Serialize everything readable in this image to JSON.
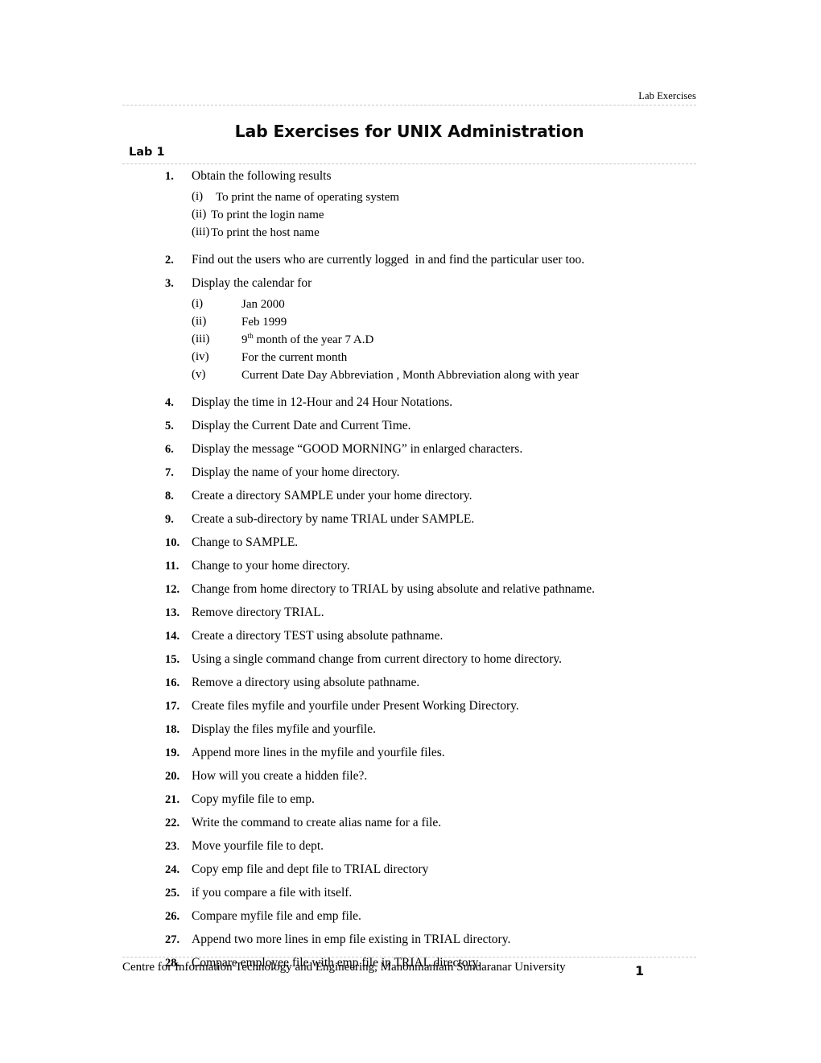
{
  "header": {
    "running_head": "Lab Exercises"
  },
  "title": "Lab Exercises for UNIX Administration",
  "lab_heading": "Lab 1",
  "exercises": [
    {
      "number": "1.",
      "text": "Obtain the following results",
      "sub": [
        {
          "label": "(i)",
          "value": "To print the name of operating system"
        },
        {
          "label": "(ii)",
          "value": "To print the login name"
        },
        {
          "label": "(iii)",
          "value": "To print the host name"
        }
      ]
    },
    {
      "number": "2.",
      "text": "Find out the users who are currently logged  in and find the particular user too."
    },
    {
      "number": "3.",
      "text": "Display the calendar for",
      "sub": [
        {
          "label": "(i)",
          "value": "Jan 2000"
        },
        {
          "label": "(ii)",
          "value": "Feb 1999"
        },
        {
          "label": "(iii)",
          "value_pre": "9",
          "value_sup": "th",
          "value_post": " month of the year 7 A.D"
        },
        {
          "label": "(iv)",
          "value": "For the current month"
        },
        {
          "label": "(v)",
          "value": "Current Date Day Abbreviation , Month Abbreviation along with year"
        }
      ]
    },
    {
      "number": "4.",
      "text": "Display the time in 12-Hour and 24 Hour Notations."
    },
    {
      "number": "5.",
      "text": "Display the Current Date and Current Time."
    },
    {
      "number": "6.",
      "text": "Display the message “GOOD MORNING” in enlarged characters."
    },
    {
      "number": "7.",
      "text": "Display the name of your home directory."
    },
    {
      "number": "8.",
      "text": "Create a directory SAMPLE under your home directory."
    },
    {
      "number": "9.",
      "text": "Create a sub-directory by name TRIAL under SAMPLE."
    },
    {
      "number": "10.",
      "text": "Change to SAMPLE."
    },
    {
      "number": "11.",
      "text": "Change to your home directory."
    },
    {
      "number": "12.",
      "text": "Change from home directory to TRIAL by using absolute and relative pathname."
    },
    {
      "number": "13.",
      "text": "Remove directory TRIAL."
    },
    {
      "number": "14.",
      "text": "Create a directory TEST using absolute pathname."
    },
    {
      "number": "15.",
      "text": "Using a single command change from current directory to home directory."
    },
    {
      "number": "16.",
      "text": "Remove a directory using absolute pathname."
    },
    {
      "number": "17.",
      "text": "Create files myfile and yourfile under Present Working Directory."
    },
    {
      "number": "18.",
      "text": "Display the files myfile and yourfile."
    },
    {
      "number": "19.",
      "text": "Append more lines in the myfile and yourfile files."
    },
    {
      "number": "20.",
      "text": "How will you create a hidden file?."
    },
    {
      "number": "21.",
      "text": "Copy myfile file to emp."
    },
    {
      "number": "22.",
      "text": "Write the command to create alias name for a file."
    },
    {
      "number": "23",
      "number_suffix": ".",
      "text": "Move yourfile file to dept."
    },
    {
      "number": "24.",
      "text": "Copy emp file and dept file to TRIAL directory"
    },
    {
      "number": "25.",
      "text": "if you compare a file with itself."
    },
    {
      "number": "26.",
      "text": "Compare myfile file and emp file."
    },
    {
      "number": "27.",
      "text": "Append two more lines in emp file existing in TRIAL directory."
    },
    {
      "number": "28.",
      "text": "Compare employee file with emp file in TRIAL directory."
    }
  ],
  "footer": {
    "text": "Centre for Information Technology and Engineering, Manonmaniam Sundaranar University",
    "page_number": "1"
  },
  "colors": {
    "text": "#000000",
    "rule": "#c9c9c9",
    "background": "#ffffff"
  }
}
